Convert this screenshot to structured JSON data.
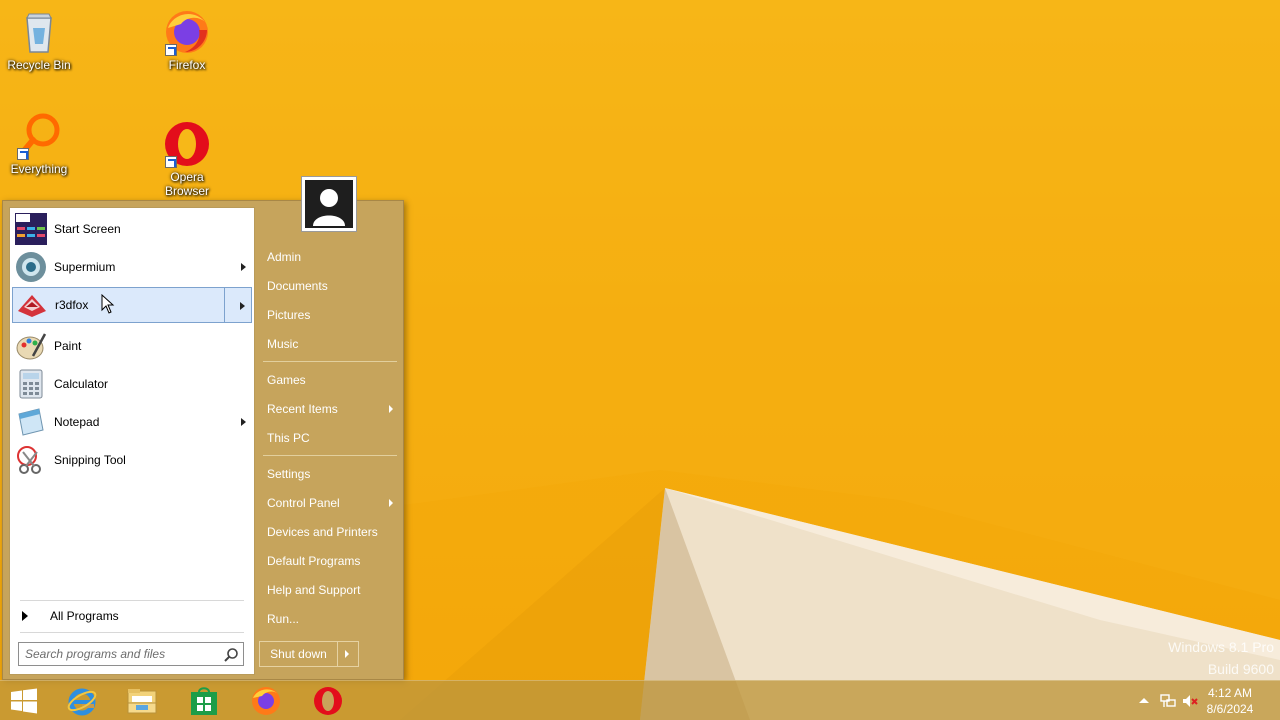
{
  "desktop": {
    "icons": [
      {
        "label": "Recycle Bin",
        "icon": "recycle-bin-icon"
      },
      {
        "label": "Firefox",
        "icon": "firefox-icon"
      },
      {
        "label": "Everything",
        "icon": "everything-search-icon"
      },
      {
        "label": "Opera Browser",
        "icon": "opera-icon"
      }
    ],
    "watermark": {
      "line1": "Windows 8.1 Pro",
      "line2": "Build 9600"
    }
  },
  "start_menu": {
    "programs": [
      {
        "label": "Start Screen",
        "icon": "start-screen-icon",
        "submenu": false,
        "highlighted": false
      },
      {
        "label": "Supermium",
        "icon": "supermium-icon",
        "submenu": true,
        "highlighted": false
      },
      {
        "label": "r3dfox",
        "icon": "r3dfox-icon",
        "submenu": true,
        "highlighted": true
      },
      {
        "label": "Paint",
        "icon": "paint-icon",
        "submenu": false,
        "highlighted": false
      },
      {
        "label": "Calculator",
        "icon": "calculator-icon",
        "submenu": false,
        "highlighted": false
      },
      {
        "label": "Notepad",
        "icon": "notepad-icon",
        "submenu": true,
        "highlighted": false
      },
      {
        "label": "Snipping Tool",
        "icon": "snipping-tool-icon",
        "submenu": false,
        "highlighted": false
      }
    ],
    "all_programs": "All Programs",
    "search_placeholder": "Search programs and files",
    "right_items": [
      {
        "label": "Admin",
        "submenu": false
      },
      {
        "label": "Documents",
        "submenu": false
      },
      {
        "label": "Pictures",
        "submenu": false
      },
      {
        "label": "Music",
        "submenu": false
      },
      {
        "label": "Games",
        "submenu": false
      },
      {
        "label": "Recent Items",
        "submenu": true
      },
      {
        "label": "This PC",
        "submenu": false
      },
      {
        "label": "Settings",
        "submenu": false
      },
      {
        "label": "Control Panel",
        "submenu": true
      },
      {
        "label": "Devices and Printers",
        "submenu": false
      },
      {
        "label": "Default Programs",
        "submenu": false
      },
      {
        "label": "Help and Support",
        "submenu": false
      },
      {
        "label": "Run...",
        "submenu": false
      }
    ],
    "shutdown_label": "Shut down"
  },
  "taskbar": {
    "pinned": [
      {
        "icon": "windows-start-icon"
      },
      {
        "icon": "internet-explorer-icon"
      },
      {
        "icon": "file-explorer-icon"
      },
      {
        "icon": "store-icon"
      },
      {
        "icon": "firefox-icon"
      },
      {
        "icon": "opera-icon"
      }
    ],
    "clock": {
      "time": "4:12 AM",
      "date": "8/6/2024"
    },
    "tray_icons": [
      "show-hidden-icons-icon",
      "network-icon",
      "volume-muted-icon"
    ]
  },
  "colors": {
    "menu_background": "#c6a45c",
    "highlight": "#dbe9fb",
    "taskbar": "#be963c"
  }
}
